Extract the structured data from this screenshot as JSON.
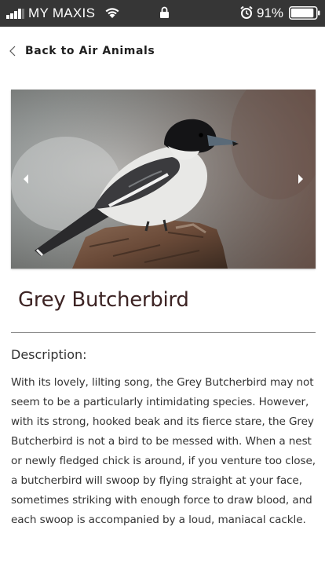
{
  "status_bar": {
    "carrier": "MY MAXIS",
    "battery_percent": "91%",
    "icons": [
      "signal-bars-icon",
      "wifi-icon",
      "lock-icon",
      "alarm-icon",
      "battery-icon"
    ]
  },
  "nav": {
    "back_label": "Back to Air Animals",
    "back_icon": "chevron-left-icon"
  },
  "carousel": {
    "image_subject": "bird-photo",
    "prev_icon": "triangle-left-icon",
    "next_icon": "triangle-right-icon"
  },
  "animal": {
    "name": "Grey Butcherbird",
    "description_heading": "Description:",
    "description": "With its lovely, lilting song, the Grey Butcherbird may not seem to be a particularly intimidating species. However, with its strong, hooked beak and its fierce stare, the Grey Butcherbird is not a bird to be messed with. When a nest or newly fledged chick is around, if you venture too close, a butcherbird will swoop by flying straight at your face, sometimes striking with enough force to draw blood, and each swoop is accompanied by a loud, maniacal cackle."
  },
  "colors": {
    "status_bar_bg": "#363636",
    "title_text": "#3d2424",
    "body_text": "#333333"
  }
}
